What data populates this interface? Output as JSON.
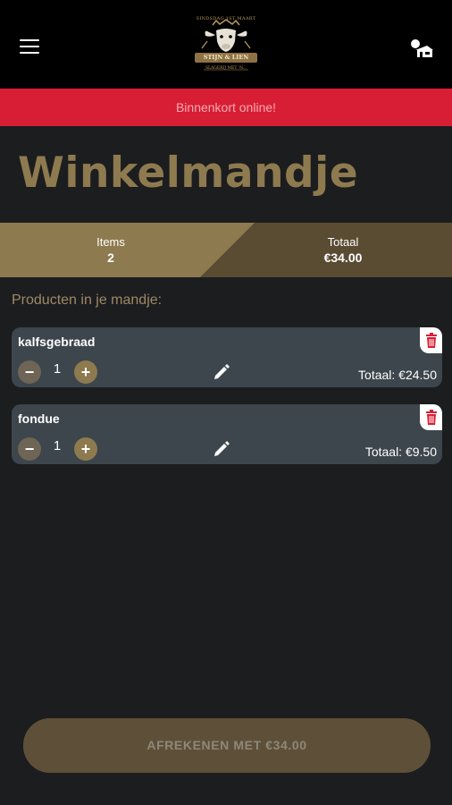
{
  "header": {
    "logo": {
      "top_text": "SINDSDAG 1ST MAART",
      "name": "STIJN & LIEN",
      "tagline": "SLAGERIJ MET 'N..."
    },
    "menu_icon": "hamburger-icon",
    "cart_icon": "shop-cart-icon"
  },
  "banner": {
    "text": "Binnenkort online!"
  },
  "page": {
    "title": "Winkelmandje"
  },
  "summary": {
    "items_label": "Items",
    "items_value": "2",
    "total_label": "Totaal",
    "total_value": "€34.00"
  },
  "products_label": "Producten in je mandje:",
  "products": [
    {
      "name": "kalfsgebraad",
      "qty": "1",
      "total": "Totaal: €24.50"
    },
    {
      "name": "fondue",
      "qty": "1",
      "total": "Totaal: €9.50"
    }
  ],
  "checkout": {
    "label": "AFREKENEN MET €34.00"
  },
  "colors": {
    "accent_gold": "#8e7a4f",
    "banner_red": "#d81e34",
    "card_bg": "#3c464c",
    "page_bg": "#1c1d1f"
  }
}
